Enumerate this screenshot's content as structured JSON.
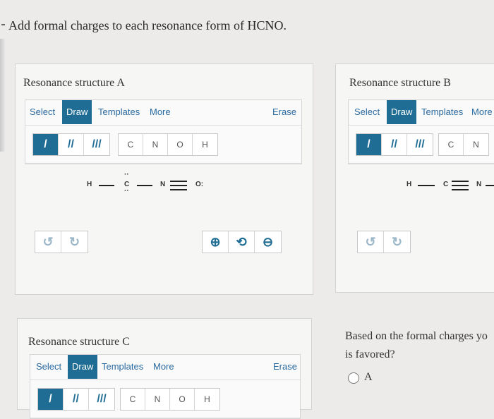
{
  "question": {
    "text": "Add formal charges to each resonance form of HCNO."
  },
  "editor_tabs": {
    "select": "Select",
    "draw": "Draw",
    "templates": "Templates",
    "more": "More",
    "erase": "Erase"
  },
  "bonds": {
    "single": "/",
    "double": "//",
    "triple": "///"
  },
  "atoms": [
    "C",
    "N",
    "O",
    "H"
  ],
  "structure_a": {
    "title": "Resonance structure A",
    "atoms": {
      "h": "H",
      "c": "C",
      "n": "N",
      "o": "O:"
    }
  },
  "structure_b": {
    "title": "Resonance structure B",
    "atoms": {
      "h": "H",
      "c": "C",
      "n": "N"
    }
  },
  "structure_c": {
    "title": "Resonance structure C"
  },
  "favored": {
    "line1": "Based on the formal charges yo",
    "line2": "is favored?",
    "option_a": "A"
  },
  "colors": {
    "accent": "#1f6d94",
    "link": "#2a6aa0"
  }
}
